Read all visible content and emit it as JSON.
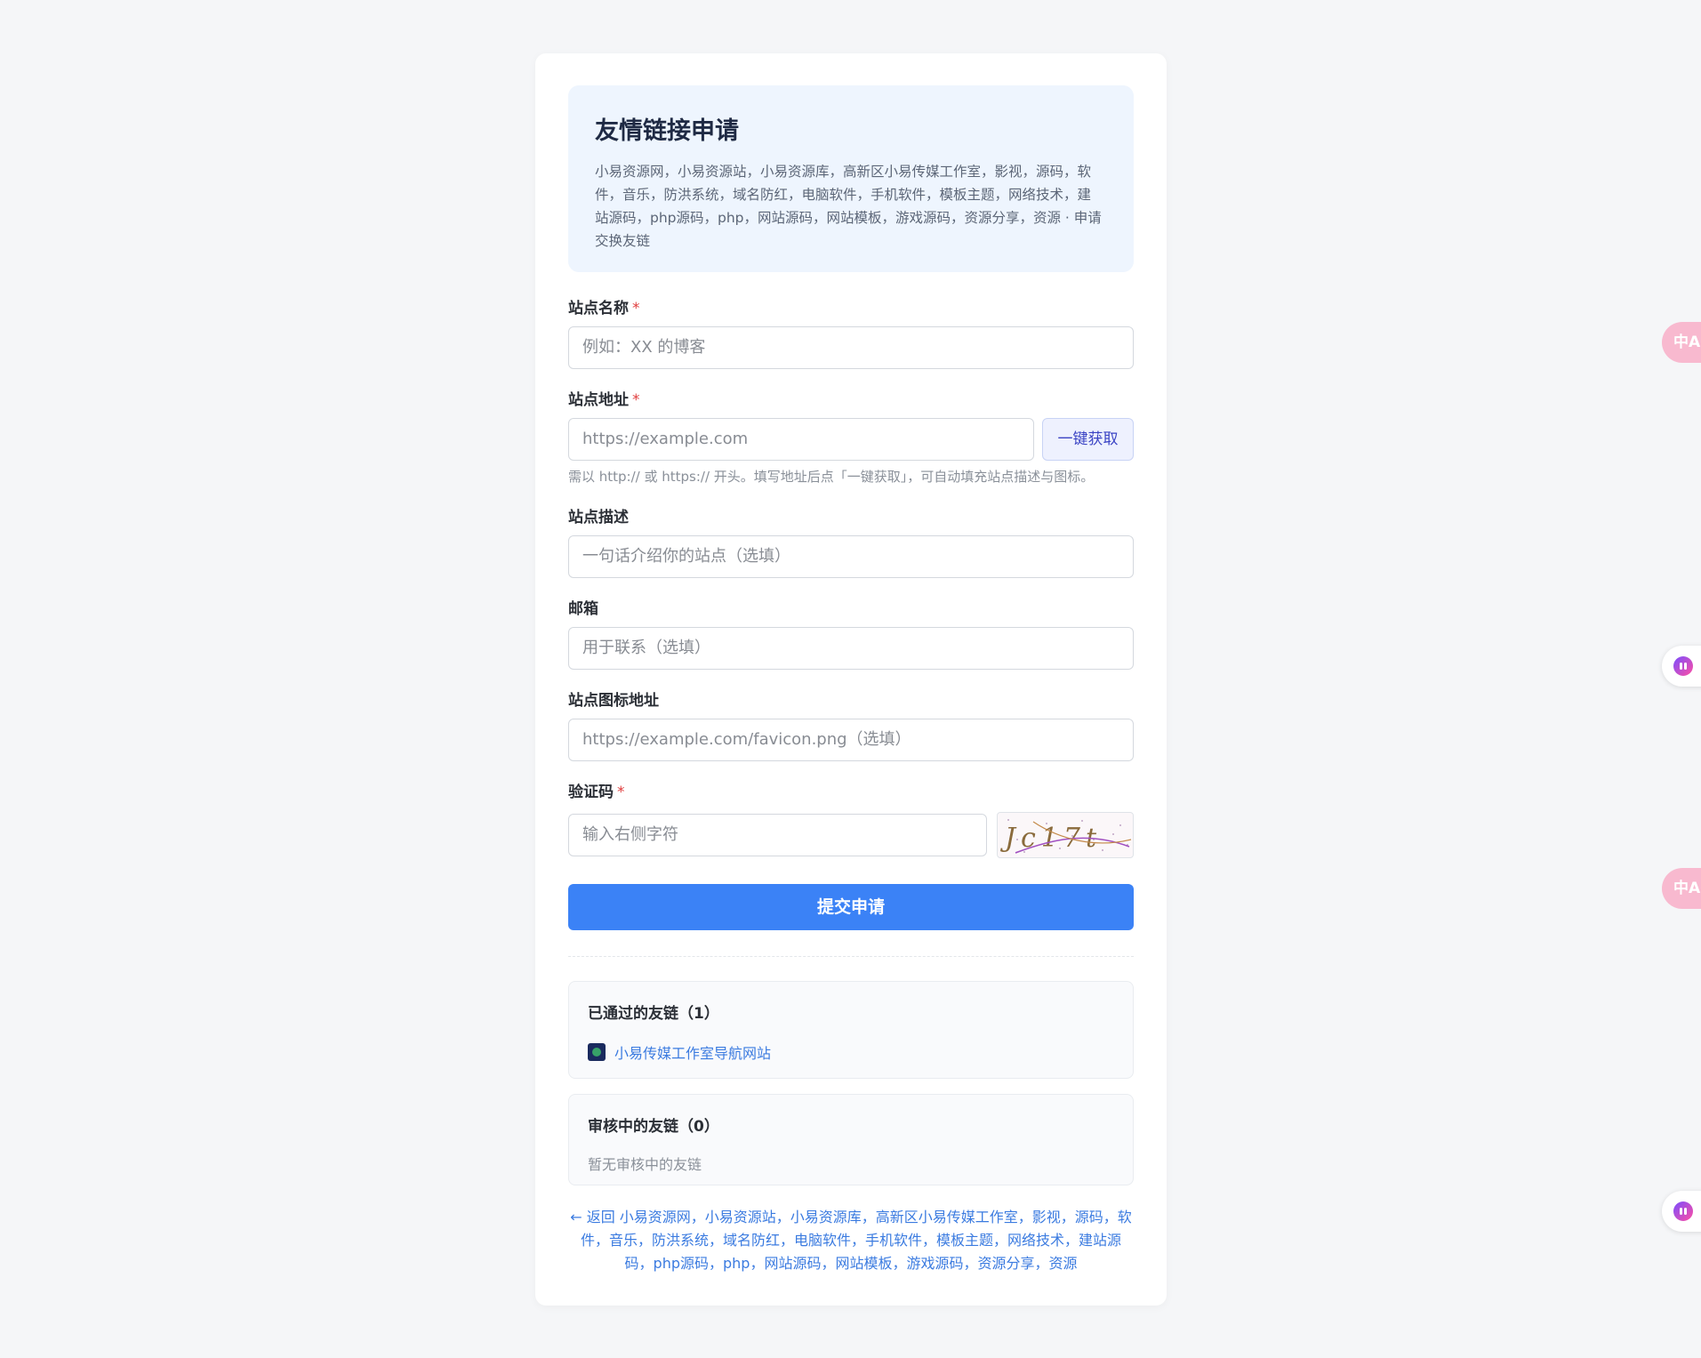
{
  "header": {
    "title": "友情链接申请",
    "description": "小易资源网，小易资源站，小易资源库，高新区小易传媒工作室，影视，源码，软件，音乐，防洪系统，域名防红，电脑软件，手机软件，模板主题，网络技术，建站源码，php源码，php，网站源码，网站模板，游戏源码，资源分享，资源 · 申请交换友链"
  },
  "form": {
    "site_name": {
      "label": "站点名称",
      "required_mark": "*",
      "placeholder": "例如：XX 的博客"
    },
    "site_url": {
      "label": "站点地址",
      "required_mark": "*",
      "placeholder": "https://example.com",
      "fetch_button": "一键获取",
      "hint": "需以 http:// 或 https:// 开头。填写地址后点「一键获取」，可自动填充站点描述与图标。"
    },
    "site_desc": {
      "label": "站点描述",
      "placeholder": "一句话介绍你的站点（选填）"
    },
    "email": {
      "label": "邮箱",
      "placeholder": "用于联系（选填）"
    },
    "icon_url": {
      "label": "站点图标地址",
      "placeholder": "https://example.com/favicon.png（选填）"
    },
    "captcha": {
      "label": "验证码",
      "required_mark": "*",
      "placeholder": "输入右侧字符",
      "image_text": "Jc17t"
    },
    "submit_label": "提交申请"
  },
  "approved": {
    "title": "已通过的友链（1）",
    "items": [
      {
        "name": "小易传媒工作室导航网站"
      }
    ]
  },
  "pending": {
    "title": "审核中的友链（0）",
    "empty_text": "暂无审核中的友链"
  },
  "back_link": "← 返回 小易资源网，小易资源站，小易资源库，高新区小易传媒工作室，影视，源码，软件，音乐，防洪系统，域名防红，电脑软件，手机软件，模板主题，网络技术，建站源码，php源码，php，网站源码，网站模板，游戏源码，资源分享，资源",
  "side_widgets": {
    "translate_icon": "translate-icon",
    "ai_icon": "ai-assistant-icon",
    "translate_glyph": "中A"
  },
  "colors": {
    "accent": "#3b82f6",
    "link": "#3b7be0",
    "required": "#e03d3d"
  }
}
